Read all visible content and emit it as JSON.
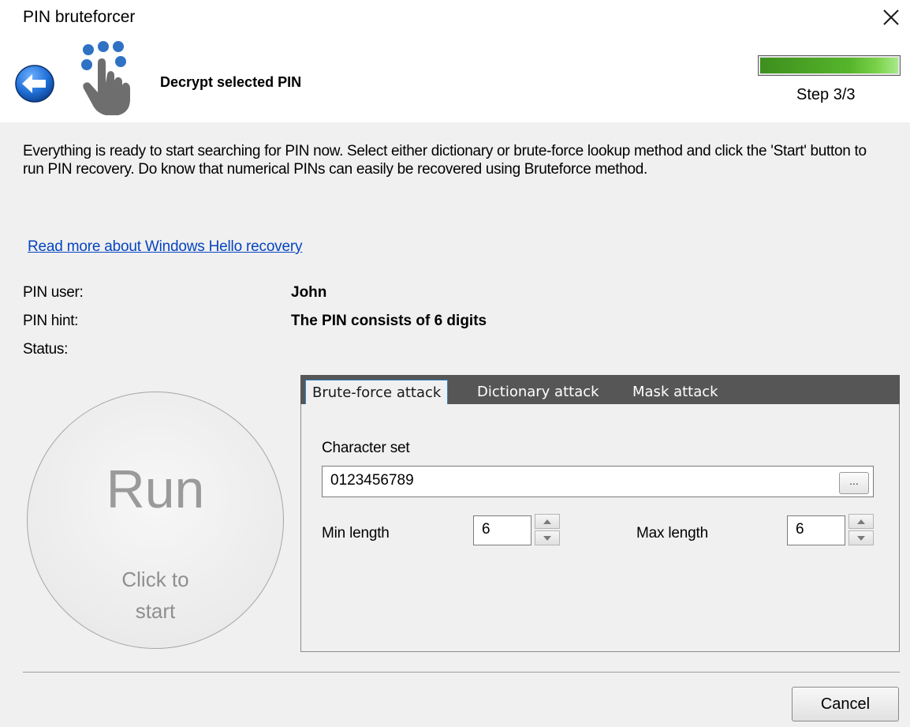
{
  "window": {
    "title": "PIN bruteforcer",
    "close_icon": "close-icon"
  },
  "header": {
    "back_icon": "arrow-left-circle-icon",
    "hero_icon": "keypad-hand-icon",
    "heading": "Decrypt selected PIN",
    "progress_fraction": 1.0,
    "step_label": "Step 3/3",
    "accent_color": "#56b52b"
  },
  "description": "Everything is ready to start searching for PIN now. Select either dictionary or brute-force lookup method and click the 'Start' button to run PIN recovery. Do know that numerical PINs can easily be recovered using Bruteforce method.",
  "link": {
    "label": "Read more about Windows Hello recovery",
    "color": "#0645c0"
  },
  "info": {
    "pin_user_label": "PIN user:",
    "pin_user_value": "John",
    "pin_hint_label": "PIN hint:",
    "pin_hint_value": "The PIN consists of 6 digits",
    "status_label": "Status:",
    "status_value": ""
  },
  "run_button": {
    "title": "Run",
    "subtitle_line1": "Click to",
    "subtitle_line2": "start"
  },
  "tabs": [
    {
      "label": "Brute-force attack",
      "active": true
    },
    {
      "label": "Dictionary attack",
      "active": false
    },
    {
      "label": "Mask attack",
      "active": false
    }
  ],
  "bruteforce": {
    "charset_label": "Character set",
    "charset_value": "0123456789",
    "browse_label": "...",
    "min_length_label": "Min length",
    "min_length_value": "6",
    "max_length_label": "Max length",
    "max_length_value": "6"
  },
  "footer": {
    "cancel_label": "Cancel"
  }
}
